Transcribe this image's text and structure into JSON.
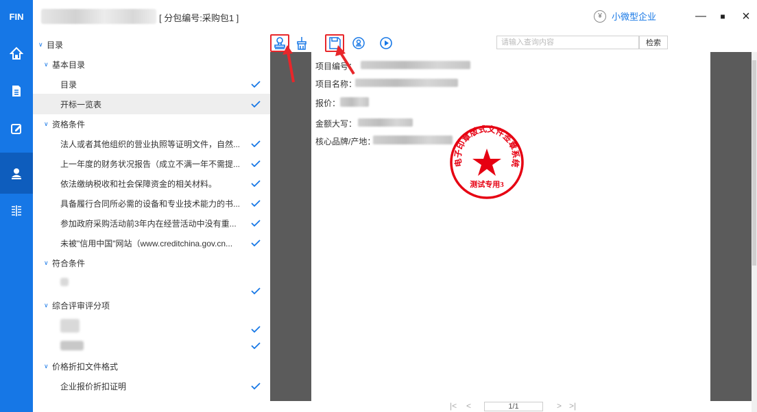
{
  "app": {
    "logo": "FIN",
    "title": "[ 分包编号:采购包1 ]"
  },
  "rail": {
    "items": [
      "home-icon",
      "document-icon",
      "edit-icon",
      "user-icon",
      "split-icon"
    ],
    "active": "user-icon"
  },
  "enterprise": {
    "icon_char": "¥",
    "label": "小微型企业"
  },
  "window": {
    "minimize": "—",
    "maximize": "■",
    "close": "×"
  },
  "tree": {
    "root": "目录",
    "sections": [
      {
        "label": "基本目录",
        "items": [
          {
            "label": "目录",
            "checked": true
          },
          {
            "label": "开标一览表",
            "checked": true,
            "selected": true
          }
        ]
      },
      {
        "label": "资格条件",
        "items": [
          {
            "label": "法人或者其他组织的营业执照等证明文件，自然...",
            "checked": true
          },
          {
            "label": "上一年度的财务状况报告（成立不满一年不需提...",
            "checked": true
          },
          {
            "label": "依法缴纳税收和社会保障资金的相关材料。",
            "checked": true
          },
          {
            "label": "具备履行合同所必需的设备和专业技术能力的书...",
            "checked": true
          },
          {
            "label": "参加政府采购活动前3年内在经营活动中没有重...",
            "checked": true
          },
          {
            "label": "未被\"信用中国\"网站（www.creditchina.gov.cn...",
            "checked": true
          }
        ]
      },
      {
        "label": "符合条件",
        "items": [
          {
            "label": "",
            "checked": true
          }
        ]
      },
      {
        "label": "综合评审评分项",
        "items": [
          {
            "label": "",
            "checked": true
          },
          {
            "label": "",
            "checked": true
          }
        ]
      },
      {
        "label": "价格折扣文件格式",
        "items": [
          {
            "label": "企业报价折扣证明",
            "checked": true
          }
        ]
      }
    ]
  },
  "toolbar": {
    "tools": [
      "stamp-icon",
      "broom-icon",
      "save-icon",
      "seal-icon",
      "play-icon"
    ],
    "search_placeholder": "请输入查询内容",
    "search_button": "检索"
  },
  "document": {
    "fields": [
      "项目编号：",
      "项目名称：",
      "报价：",
      "金额大写：",
      "核心品牌/产地："
    ],
    "stamp_text": "电子印章版式文件签章系统",
    "stamp_footer": "测试专用3"
  },
  "pager": {
    "first": "|<",
    "prev": "<",
    "page": "1/1",
    "next": ">",
    "last": ">|"
  },
  "colors": {
    "accent": "#1677e6",
    "highlight": "#e8262a",
    "stamp": "#e60012",
    "viewer_bg": "#5b5b5b"
  }
}
